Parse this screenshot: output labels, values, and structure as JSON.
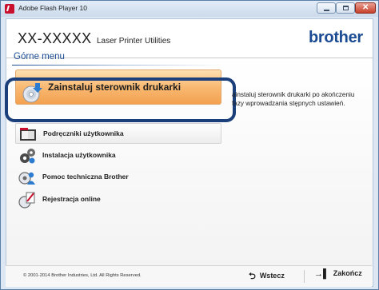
{
  "window": {
    "title": "Adobe Flash Player 10"
  },
  "header": {
    "model": "XX-XXXXX",
    "subtitle": "Laser Printer Utilities",
    "brand": "brother"
  },
  "menu": {
    "title": "Górne menu",
    "main_button": {
      "label": "Zainstaluj sterownik drukarki",
      "icon": "disc-install-icon"
    },
    "description": "ainstaluj sterownik drukarki po akończeniu fazy wprowadzania stępnych ustawień.",
    "items": [
      {
        "label": "Podręczniki użytkownika",
        "icon": "manual-icon"
      },
      {
        "label": "Instalacja użytkownika",
        "icon": "gears-icon"
      },
      {
        "label": "Pomoc techniczna Brother",
        "icon": "support-icon"
      },
      {
        "label": "Rejestracja online",
        "icon": "registration-icon"
      }
    ]
  },
  "footer": {
    "copyright": "© 2001-2014 Brother Industries, Ltd. All Rights Reserved.",
    "back_label": "Wstecz",
    "exit_label": "Zakończ"
  },
  "colors": {
    "accent": "#1b4c93",
    "main_button": "#f8b972",
    "focus_ring": "#1a3f7a"
  }
}
